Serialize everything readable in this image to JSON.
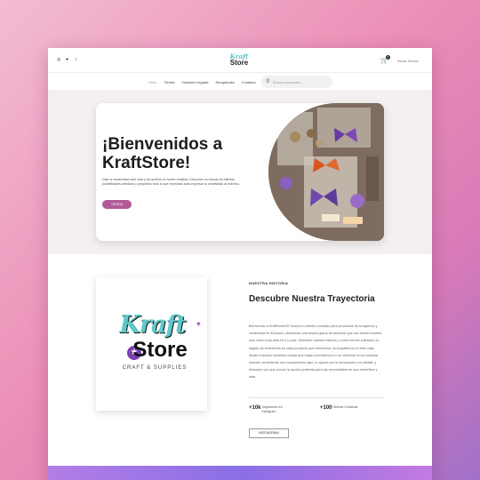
{
  "header": {
    "social_icons": [
      "instagram-icon",
      "facebook-icon",
      "tiktok-icon"
    ],
    "logo": {
      "line1": "Kraft",
      "line2": "Store"
    },
    "cart_count": "0",
    "login_label": "Iniciar Sesión"
  },
  "nav": {
    "items": [
      {
        "label": "Inicio"
      },
      {
        "label": "Tienda"
      },
      {
        "label": "Ocasión Llegada"
      },
      {
        "label": "Scrapbooks"
      },
      {
        "label": "Contacto"
      }
    ],
    "search_placeholder": "Buscar productos..."
  },
  "hero": {
    "title": "¡Bienvenidos a KraftStore!",
    "description": "Dale la creatividad color vida y los sueños se hacen realidad. Descubre un mundo de infinitas posibilidades artísticas y pequeños todo lo que necesitas para expresar tu creatividad al máximo.",
    "button_label": "TIENDA"
  },
  "story": {
    "logo": {
      "kraft": "Kraft",
      "store": "Store",
      "tagline": "CRAFT & SUPPLIES"
    },
    "eyebrow": "NUESTRA HISTORIA",
    "title": "Descubre Nuestra Trayectoria",
    "body": "Bienvenido a KraftStoreKD Somos tu destino confiado para productos de scrapbook y creatividad en Ecuador, ofreciendo una amplia gama de artículos que van desde modelo, sino como toda idea en ti y más. Descubre nuestra historia y cómo hemos cultivado un legado de excelencia en cada producto que ofrecemos. Acompáñenos en este viaje, desde nuestros humildes comienzos hasta convertirnos en un referente en la industria. Nuestro crecimiento nos compartirnos aquí, tu aporte por la innovación y la calidad, y descubre por qué somos la opción preferida para las necesidades de sus celebrities y más.",
    "stats": [
      {
        "value": "+10k",
        "label": "Seguidores en Instagram"
      },
      {
        "value": "+100",
        "label": "Ofertas Creativas"
      }
    ],
    "button_label": "INSTAGRAM"
  },
  "colors": {
    "accent": "#b35a96",
    "brand_teal": "#5fc9cb",
    "brand_purple": "#7e3fb0"
  }
}
